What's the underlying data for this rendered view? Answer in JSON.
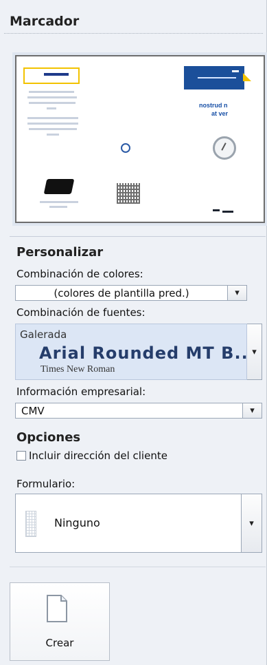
{
  "marcador": {
    "title": "Marcador",
    "preview": {
      "headline_line1": "nostrud n",
      "headline_line2": "at ver"
    }
  },
  "personalizar": {
    "title": "Personalizar",
    "color_scheme": {
      "label": "Combinación de colores:",
      "value": "(colores de plantilla pred.)"
    },
    "font_scheme": {
      "label": "Combinación de fuentes:",
      "name": "Galerada",
      "major_font": "Arial Rounded MT B...",
      "minor_font": "Times New Roman"
    },
    "business_info": {
      "label": "Información empresarial:",
      "value": "CMV"
    }
  },
  "opciones": {
    "title": "Opciones",
    "include_customer_address": {
      "label": "Incluir dirección del cliente",
      "checked": false
    },
    "form": {
      "label": "Formulario:",
      "value": "Ninguno"
    }
  },
  "actions": {
    "create_label": "Crear"
  },
  "icons": {
    "dropdown": "chevron-down-icon",
    "document": "new-document-icon",
    "form": "form-icon"
  }
}
